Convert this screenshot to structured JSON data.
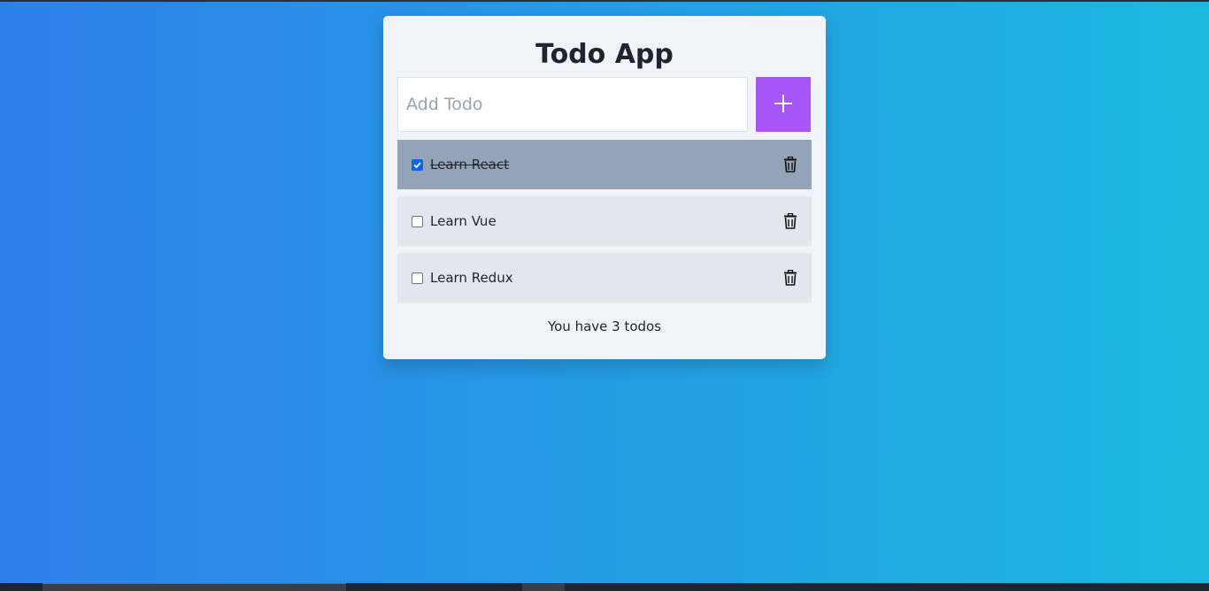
{
  "app": {
    "title": "Todo App",
    "input_placeholder": "Add Todo",
    "add_icon": "plus-icon",
    "footer_text": "You have 3 todos"
  },
  "todos": [
    {
      "label": "Learn React",
      "completed": true
    },
    {
      "label": "Learn Vue",
      "completed": false
    },
    {
      "label": "Learn Redux",
      "completed": false
    }
  ],
  "colors": {
    "background_start": "#2f7fea",
    "background_end": "#1db8df",
    "card": "#f0f3f8",
    "add_button": "#a855f7",
    "completed_row": "#95a3b8",
    "open_row": "#e2e7ef",
    "checkbox_checked": "#0b66e4"
  }
}
